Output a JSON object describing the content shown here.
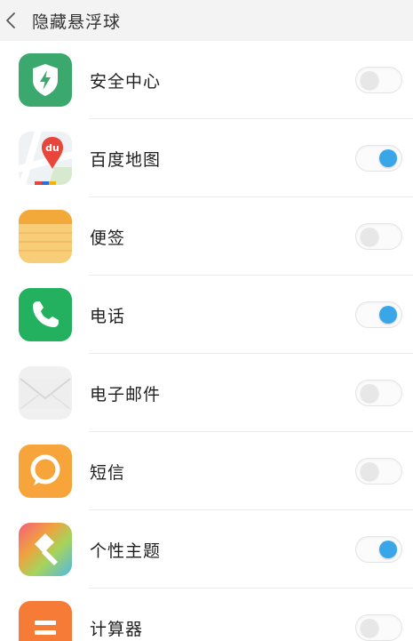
{
  "header": {
    "back_icon": "chevron-left-icon",
    "title": "隐藏悬浮球"
  },
  "apps": [
    {
      "label": "安全中心",
      "icon": "security-shield-icon",
      "enabled": false
    },
    {
      "label": "百度地图",
      "icon": "baidu-map-icon",
      "icon_text": "du",
      "enabled": true
    },
    {
      "label": "便签",
      "icon": "notes-icon",
      "enabled": false
    },
    {
      "label": "电话",
      "icon": "phone-icon",
      "enabled": true
    },
    {
      "label": "电子邮件",
      "icon": "mail-icon",
      "enabled": false
    },
    {
      "label": "短信",
      "icon": "sms-icon",
      "enabled": false
    },
    {
      "label": "个性主题",
      "icon": "theme-icon",
      "enabled": true
    },
    {
      "label": "计算器",
      "icon": "calculator-icon",
      "enabled": false
    }
  ],
  "colors": {
    "toggle_on": "#3aa6ea",
    "toggle_off": "#e7e7e7",
    "header_bg": "#f3f3f3"
  }
}
